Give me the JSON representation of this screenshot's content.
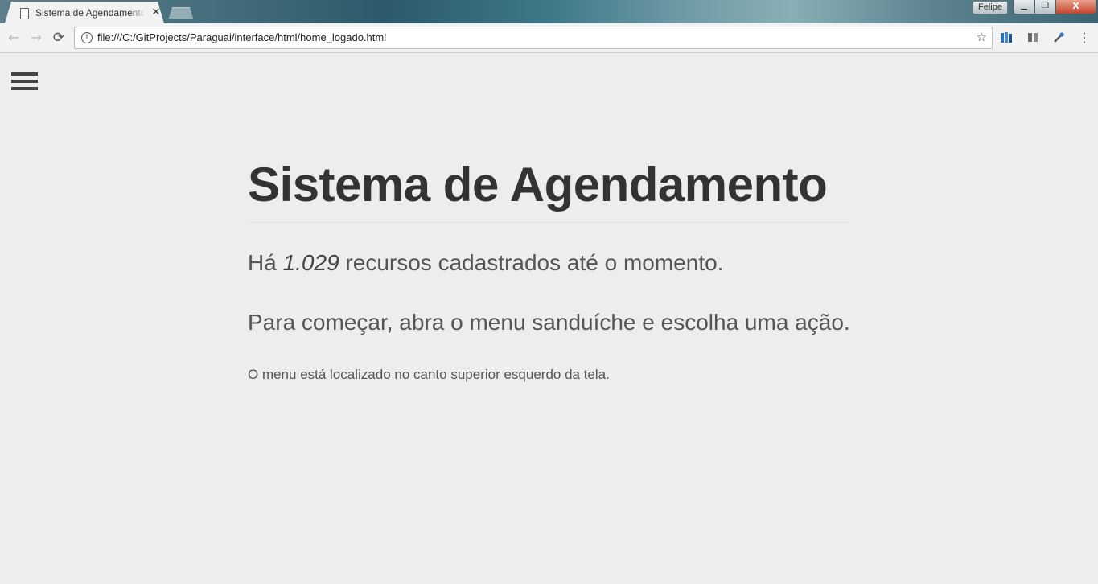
{
  "browser": {
    "tab": {
      "title": "Sistema de Agendamento",
      "close_glyph": "✕"
    },
    "user_label": "Felipe",
    "window_controls": {
      "minimize": "▁",
      "maximize": "❐",
      "close": "X"
    },
    "nav": {
      "back": "←",
      "forward": "→",
      "reload": "⟳"
    },
    "address_bar": {
      "info_glyph": "i",
      "url": "file:///C:/GitProjects/Paraguai/interface/html/home_logado.html",
      "bookmark_glyph": "☆"
    },
    "menu_glyph": "⋮",
    "extensions": [
      "bookmark-manager-icon",
      "reader-icon",
      "eyedropper-icon"
    ]
  },
  "page": {
    "title": "Sistema de Agendamento",
    "resource_line": {
      "prefix": "Há ",
      "count": "1.029",
      "suffix": " recursos cadastrados até o momento."
    },
    "instruction": "Para começar, abra o menu sanduíche e escolha uma ação.",
    "note": "O menu está localizado no canto superior esquerdo da tela."
  },
  "colors": {
    "page_background": "#ededed",
    "title_text": "#333333",
    "body_text": "#555555",
    "hamburger": "#444444"
  }
}
